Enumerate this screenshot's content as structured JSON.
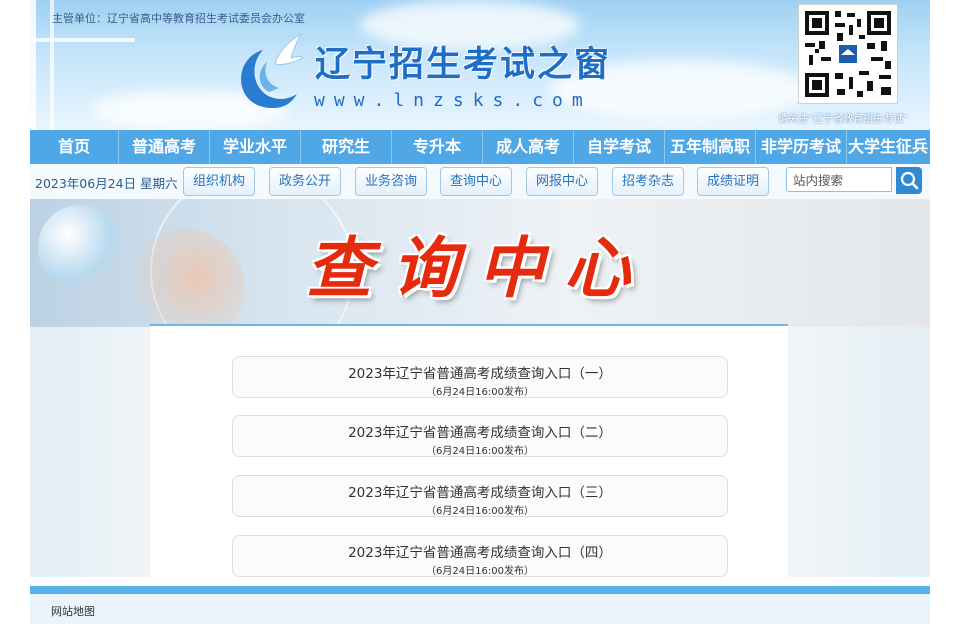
{
  "header": {
    "sponsor": "主管单位：辽宁省高中等教育招生考试委员会办公室",
    "site_name": "辽宁招生考试之窗",
    "site_url": "www.lnzsks.com",
    "qr_note": "请关注“辽宁省教育招生考试”"
  },
  "main_nav": [
    "首页",
    "普通高考",
    "学业水平",
    "研究生",
    "专升本",
    "成人高考",
    "自学考试",
    "五年制高职",
    "非学历考试",
    "大学生征兵"
  ],
  "sub_bar": {
    "date": "2023年06月24日 星期六",
    "buttons": [
      "组织机构",
      "政务公开",
      "业务咨询",
      "查询中心",
      "网报中心",
      "招考杂志",
      "成绩证明"
    ],
    "search_placeholder": "站内搜索"
  },
  "banner": {
    "title": "查询中心"
  },
  "entries": [
    {
      "title": "2023年辽宁省普通高考成绩查询入口（一）",
      "note": "（6月24日16:00发布）"
    },
    {
      "title": "2023年辽宁省普通高考成绩查询入口（二）",
      "note": "（6月24日16:00发布）"
    },
    {
      "title": "2023年辽宁省普通高考成绩查询入口（三）",
      "note": "（6月24日16:00发布）"
    },
    {
      "title": "2023年辽宁省普通高考成绩查询入口（四）",
      "note": "（6月24日16:00发布）"
    }
  ],
  "footer": {
    "link": "网站地图"
  },
  "colors": {
    "nav": "#4fa7e5",
    "accent": "#2e8ad3",
    "banner_title": "#e52a0e"
  }
}
